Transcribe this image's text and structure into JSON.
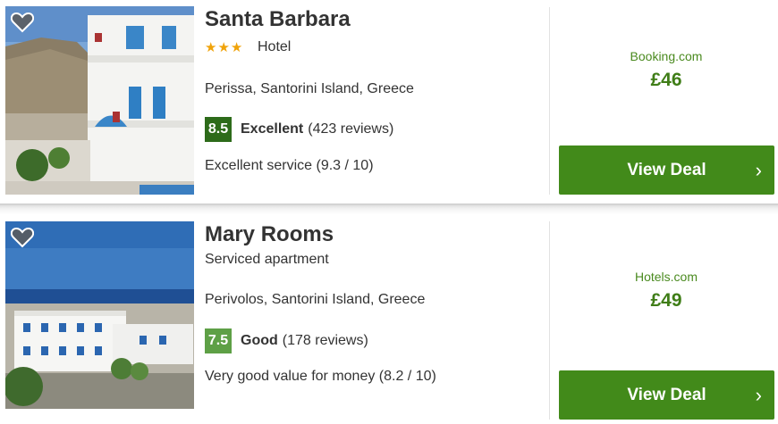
{
  "listings": [
    {
      "name": "Santa Barbara",
      "stars": "★★★",
      "type": "Hotel",
      "location": "Perissa, Santorini Island, Greece",
      "score": "8.5",
      "rating_word": "Excellent",
      "reviews": "(423 reviews)",
      "highlight": "Excellent service (9.3 / 10)",
      "provider": "Booking.com",
      "price": "£46",
      "deal_label": "View Deal"
    },
    {
      "name": "Mary Rooms",
      "type": "Serviced apartment",
      "location": "Perivolos, Santorini Island, Greece",
      "score": "7.5",
      "rating_word": "Good",
      "reviews": "(178 reviews)",
      "highlight": "Very good value for money (8.2 / 10)",
      "provider": "Hotels.com",
      "price": "£49",
      "deal_label": "View Deal"
    }
  ],
  "icons": {
    "favorite": "heart-icon",
    "chevron": "chevron-right-icon"
  },
  "colors": {
    "deal_button": "#428a1a",
    "price": "#3f7d17",
    "star": "#f0a30a",
    "score_excellent": "#2d6b1a",
    "score_good": "#5ea046"
  }
}
